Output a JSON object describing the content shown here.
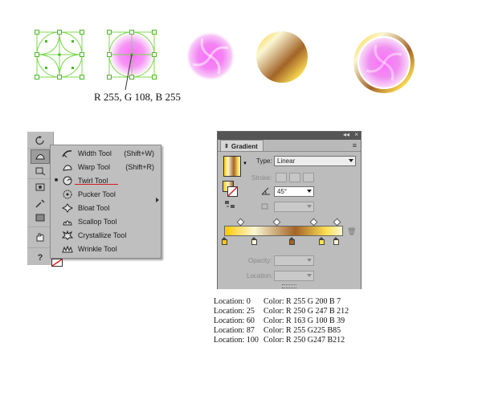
{
  "caption": "R 255, G 108, B 255",
  "gradient_panel": {
    "title": "Gradient",
    "type_label": "Type:",
    "type_value": "Linear",
    "stroke_label": "Stroke:",
    "angle_value": "45°",
    "opacity_label": "Opacity:",
    "location_label": "Location:",
    "stops": [
      {
        "location": 0,
        "color": "#ffc807"
      },
      {
        "location": 25,
        "color": "#faf7d4"
      },
      {
        "location": 60,
        "color": "#a36427"
      },
      {
        "location": 87,
        "color": "#ffe155"
      },
      {
        "location": 100,
        "color": "#faf7d4"
      }
    ],
    "midpoints": [
      12.5,
      42.5,
      73.5,
      93.5
    ]
  },
  "tools_flyout": {
    "items": [
      {
        "label": "Width Tool",
        "shortcut": "(Shift+W)",
        "icon": "width-tool-icon",
        "selected": false
      },
      {
        "label": "Warp Tool",
        "shortcut": "(Shift+R)",
        "icon": "warp-tool-icon",
        "selected": false
      },
      {
        "label": "Twirl Tool",
        "shortcut": "",
        "icon": "twirl-tool-icon",
        "selected": true
      },
      {
        "label": "Pucker Tool",
        "shortcut": "",
        "icon": "pucker-tool-icon",
        "selected": false
      },
      {
        "label": "Bloat Tool",
        "shortcut": "",
        "icon": "bloat-tool-icon",
        "selected": false
      },
      {
        "label": "Scallop Tool",
        "shortcut": "",
        "icon": "scallop-tool-icon",
        "selected": false
      },
      {
        "label": "Crystallize Tool",
        "shortcut": "",
        "icon": "crystallize-tool-icon",
        "selected": false
      },
      {
        "label": "Wrinkle Tool",
        "shortcut": "",
        "icon": "wrinkle-tool-icon",
        "selected": false
      }
    ],
    "toolbar_help": "?"
  },
  "locations": [
    {
      "loc": "Location: 0",
      "color": "Color: R 255 G 200 B 7"
    },
    {
      "loc": "Location: 25",
      "color": "Color: R 250 G 247 B 212"
    },
    {
      "loc": "Location: 60",
      "color": "Color: R 163 G 100 B 39"
    },
    {
      "loc": "Location: 87",
      "color": "Color: R 255 G225 B85"
    },
    {
      "loc": "Location: 100",
      "color": "Color: R 250 G247 B212"
    }
  ],
  "colors": {
    "magenta": "#ff6cff",
    "selection_green": "#7cd84a",
    "gold": "#ffc807",
    "cream": "#faf7d4",
    "brown": "#a36427",
    "yellow": "#ffe155"
  }
}
